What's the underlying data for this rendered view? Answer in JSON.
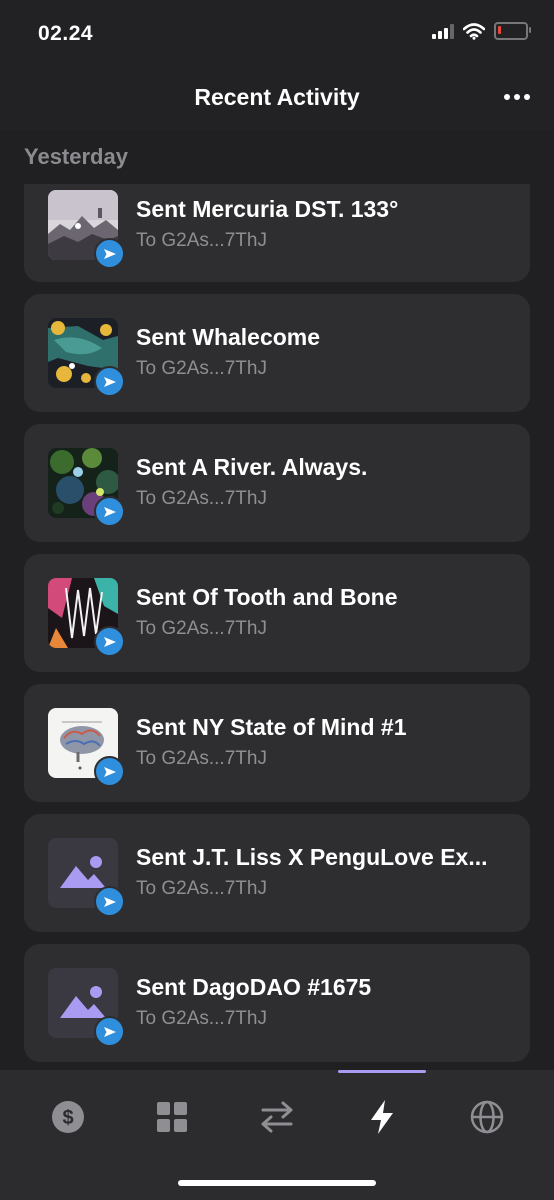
{
  "status_bar": {
    "time": "02.24"
  },
  "header": {
    "title": "Recent Activity"
  },
  "section": {
    "title": "Yesterday"
  },
  "activities": [
    {
      "title": "Sent Mercuria DST. 133°",
      "subtitle": "To G2As...7ThJ",
      "thumb": "mercuria-art"
    },
    {
      "title": "Sent Whalecome",
      "subtitle": "To G2As...7ThJ",
      "thumb": "whalecome-art"
    },
    {
      "title": "Sent A River. Always.",
      "subtitle": "To G2As...7ThJ",
      "thumb": "river-art"
    },
    {
      "title": "Sent Of Tooth and Bone",
      "subtitle": "To G2As...7ThJ",
      "thumb": "tooth-bone-art"
    },
    {
      "title": "Sent NY State of Mind #1",
      "subtitle": "To G2As...7ThJ",
      "thumb": "brain-art"
    },
    {
      "title": "Sent J.T. Liss X PenguLove Ex...",
      "subtitle": "To G2As...7ThJ",
      "thumb": "placeholder-image-icon"
    },
    {
      "title": "Sent DagoDAO #1675",
      "subtitle": "To G2As...7ThJ",
      "thumb": "placeholder-image-icon"
    }
  ],
  "tabs": [
    {
      "icon": "dollar-icon"
    },
    {
      "icon": "grid-icon"
    },
    {
      "icon": "swap-icon"
    },
    {
      "icon": "lightning-icon",
      "active": true
    },
    {
      "icon": "globe-icon"
    }
  ],
  "colors": {
    "accent": "#a99af2",
    "send_badge": "#2f8fdc",
    "card": "#2e2e31"
  }
}
